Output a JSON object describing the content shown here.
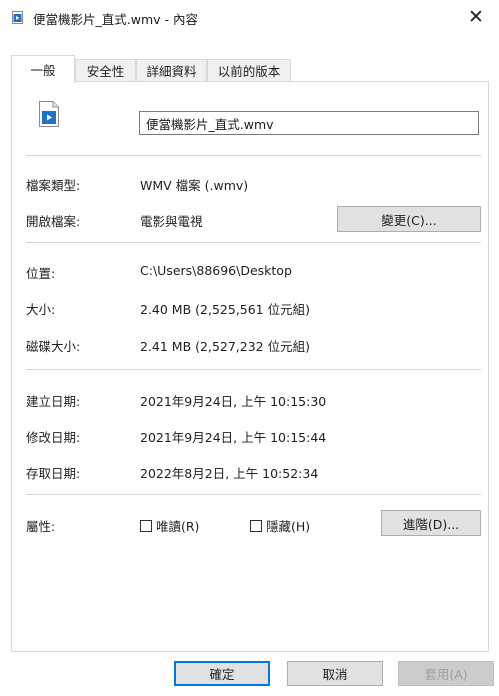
{
  "window": {
    "title": "便當機影片_直式.wmv - 內容"
  },
  "tabs": [
    {
      "label": "一般"
    },
    {
      "label": "安全性"
    },
    {
      "label": "詳細資料"
    },
    {
      "label": "以前的版本"
    }
  ],
  "general": {
    "file_name": "便當機影片_直式.wmv",
    "file_type": {
      "label": "檔案類型:",
      "value": "WMV 檔案 (.wmv)"
    },
    "opens_with": {
      "label": "開啟檔案:",
      "value": "電影與電視",
      "button": "變更(C)..."
    },
    "location": {
      "label": "位置:",
      "value": "C:\\Users\\88696\\Desktop"
    },
    "size": {
      "label": "大小:",
      "value": "2.40 MB (2,525,561 位元組)"
    },
    "size_on_disk": {
      "label": "磁碟大小:",
      "value": "2.41 MB (2,527,232 位元組)"
    },
    "created": {
      "label": "建立日期:",
      "value": "2021年9月24日, 上午 10:15:30"
    },
    "modified": {
      "label": "修改日期:",
      "value": "2021年9月24日, 上午 10:15:44"
    },
    "accessed": {
      "label": "存取日期:",
      "value": "2022年8月2日, 上午 10:52:34"
    },
    "attributes": {
      "label": "屬性:",
      "readonly": {
        "label": "唯讀(R)",
        "checked": false
      },
      "hidden": {
        "label": "隱藏(H)",
        "checked": false
      },
      "advanced_button": "進階(D)..."
    }
  },
  "footer": {
    "ok": "確定",
    "cancel": "取消",
    "apply": "套用(A)"
  },
  "colors": {
    "accent": "#0078d7",
    "file_icon": "#1e73c8"
  }
}
